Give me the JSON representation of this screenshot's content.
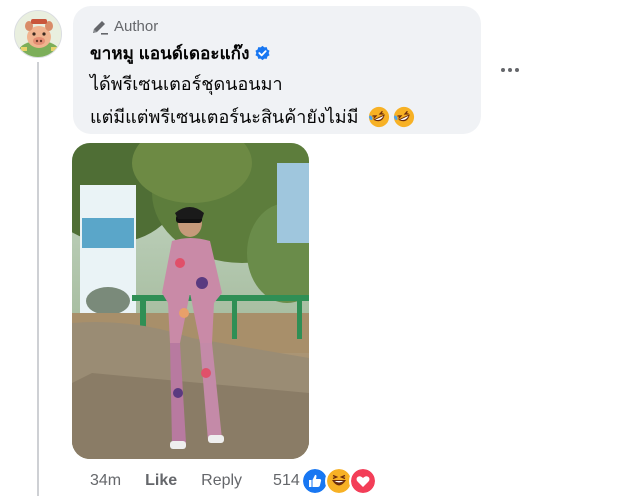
{
  "comment": {
    "author_badge": "Author",
    "author_name": "ขาหมู แอนด์เดอะแก๊ง",
    "verified_icon": "verified-badge-icon",
    "text_line_1": "ได้พรีเซนเตอร์ชุดนอนมา",
    "text_line_2": "แต่มีแต่พรีเซนเตอร์นะสินค้ายังไม่มี",
    "text_emojis": [
      "rolling-on-floor-laughing-icon",
      "rolling-on-floor-laughing-icon"
    ],
    "more_icon": "more-options-icon",
    "photo_alt": "Photo of a person in sunglasses wearing patterned pajamas standing outdoors in front of a green railing and trees"
  },
  "footer": {
    "time": "34m",
    "like_label": "Like",
    "reply_label": "Reply",
    "reaction_count": "514",
    "reactions": [
      "like-reaction-icon",
      "haha-reaction-icon",
      "love-reaction-icon"
    ]
  },
  "colors": {
    "bubble_bg": "#f0f2f5",
    "verified_blue": "#1877f2",
    "secondary_text": "#65676b",
    "love_red": "#f33e58",
    "haha_yellow": "#f7b125"
  }
}
